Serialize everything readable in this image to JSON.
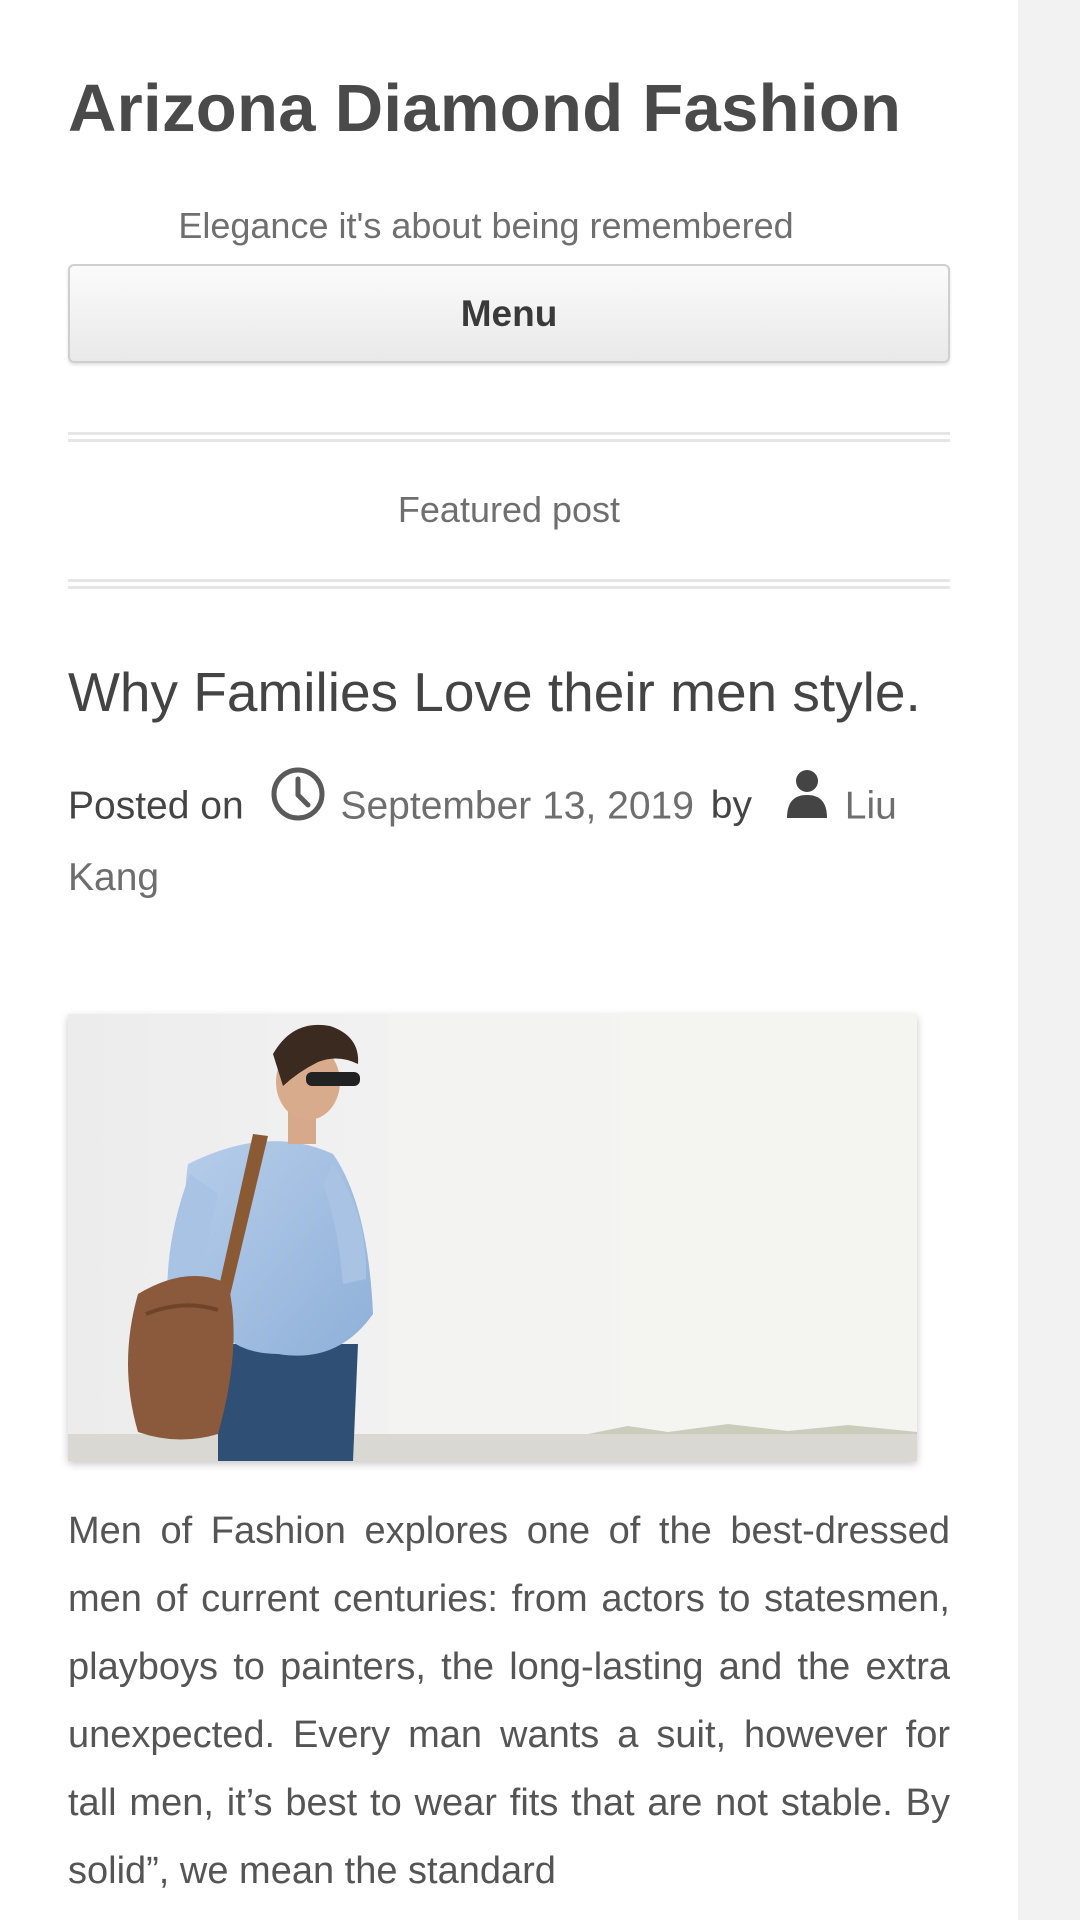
{
  "site": {
    "title": "Arizona Diamond Fashion",
    "tagline": "Elegance it's about being remembered"
  },
  "nav": {
    "menu_label": "Menu"
  },
  "featured": {
    "label": "Featured post"
  },
  "post": {
    "title": "Why Families Love their men style.",
    "posted_on_label": "Posted on",
    "date": "September 13, 2019",
    "by_label": "by",
    "author": "Liu Kang",
    "image_icon": "man-with-bag-photo",
    "body": "Men of Fashion explores one of the best-dressed men of current centuries: from actors to statesmen, playboys to painters, the long-lasting and the extra unexpected. Every man wants a suit, however for tall men, it’s best to wear fits that are not stable. By solid”, we mean the standard"
  },
  "icons": {
    "date": "clock-icon",
    "author": "user-icon"
  },
  "colors": {
    "title_text": "#4a4a4a",
    "link_text": "#6e6e6e",
    "page_bg": "#ffffff",
    "side_bg": "#f2f2f2"
  }
}
